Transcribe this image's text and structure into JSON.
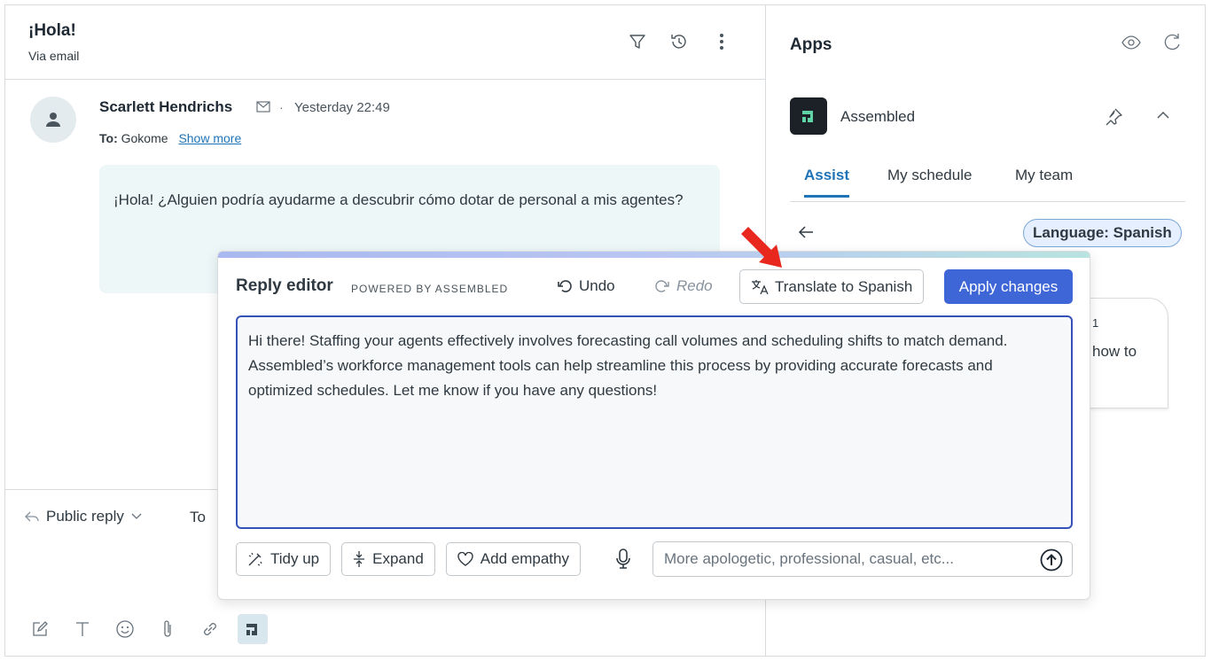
{
  "ticket": {
    "title": "¡Hola!",
    "subtitle": "Via email",
    "icons": [
      "filter-icon",
      "history-icon",
      "more-vertical-icon"
    ]
  },
  "message": {
    "sender": "Scarlett Hendrichs",
    "separator": "·",
    "time": "Yesterday 22:49",
    "to_label": "To:",
    "to_value": "Gokome",
    "show_more": "Show more",
    "body": "¡Hola! ¿Alguien podría ayudarme a descubrir cómo dotar de personal a mis agentes?"
  },
  "reply_bar": {
    "reply_type": "Public reply",
    "to_label": "To",
    "toolbar_icons": [
      "compose-icon",
      "text-format-icon",
      "emoji-icon",
      "attachment-icon",
      "link-icon",
      "assembled-app-icon"
    ]
  },
  "apps": {
    "title": "Apps",
    "app_name": "Assembled",
    "tabs": [
      "Assist",
      "My schedule",
      "My team"
    ],
    "active_tab": "Assist",
    "language_badge": "Language: Spanish",
    "peek_text": "how to",
    "peek_fragment": "1"
  },
  "editor": {
    "title": "Reply editor",
    "powered_by": "POWERED BY ASSEMBLED",
    "undo_label": "Undo",
    "redo_label": "Redo",
    "translate_label": "Translate to Spanish",
    "apply_label": "Apply changes",
    "draft": "Hi there! Staffing your agents effectively involves forecasting call volumes and scheduling shifts to match demand. Assembled’s workforce management tools can help streamline this process by providing accurate forecasts and optimized schedules. Let me know if you have any questions!",
    "actions": [
      "Tidy up",
      "Expand",
      "Add empathy"
    ],
    "prompt_placeholder": "More apologetic, professional, casual, etc...",
    "accent_color": "#3f66d6"
  },
  "annotation": {
    "arrow_color": "#e8281e"
  }
}
